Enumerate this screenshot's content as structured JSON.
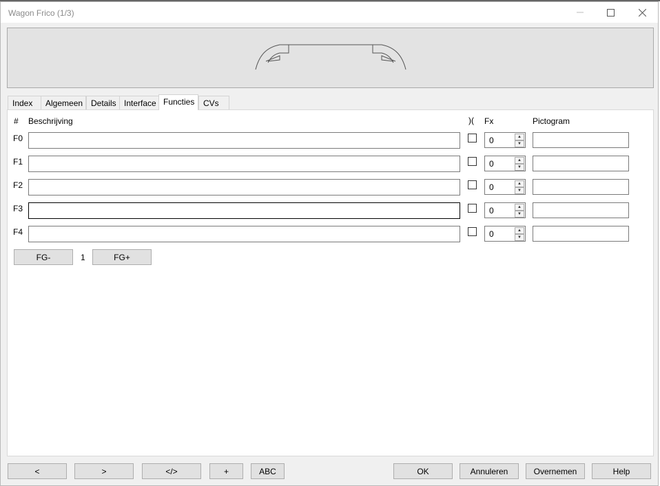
{
  "window": {
    "title": "Wagon Frico (1/3)"
  },
  "tabs": [
    "Index",
    "Algemeen",
    "Details",
    "Interface",
    "Functies",
    "CVs"
  ],
  "active_tab": "Functies",
  "functions": {
    "headers": {
      "number": "#",
      "description": "Beschrijving",
      "toggle": ")(",
      "fx": "Fx",
      "pictogram": "Pictogram"
    },
    "rows": [
      {
        "label": "F0",
        "description": "",
        "toggle": false,
        "fx": "0",
        "pictogram": ""
      },
      {
        "label": "F1",
        "description": "",
        "toggle": false,
        "fx": "0",
        "pictogram": ""
      },
      {
        "label": "F2",
        "description": "",
        "toggle": false,
        "fx": "0",
        "pictogram": ""
      },
      {
        "label": "F3",
        "description": "",
        "toggle": false,
        "fx": "0",
        "pictogram": ""
      },
      {
        "label": "F4",
        "description": "",
        "toggle": false,
        "fx": "0",
        "pictogram": ""
      }
    ],
    "group_prev": "FG-",
    "group_value": "1",
    "group_next": "FG+"
  },
  "footer": {
    "prev": "<",
    "next": ">",
    "code": "</>",
    "add": "+",
    "abc": "ABC",
    "ok": "OK",
    "cancel": "Annuleren",
    "apply": "Overnemen",
    "help": "Help"
  },
  "icons": {
    "minimize": "minimize-icon",
    "maximize": "maximize-icon",
    "close": "close-icon",
    "wagon": "wagon-image"
  }
}
